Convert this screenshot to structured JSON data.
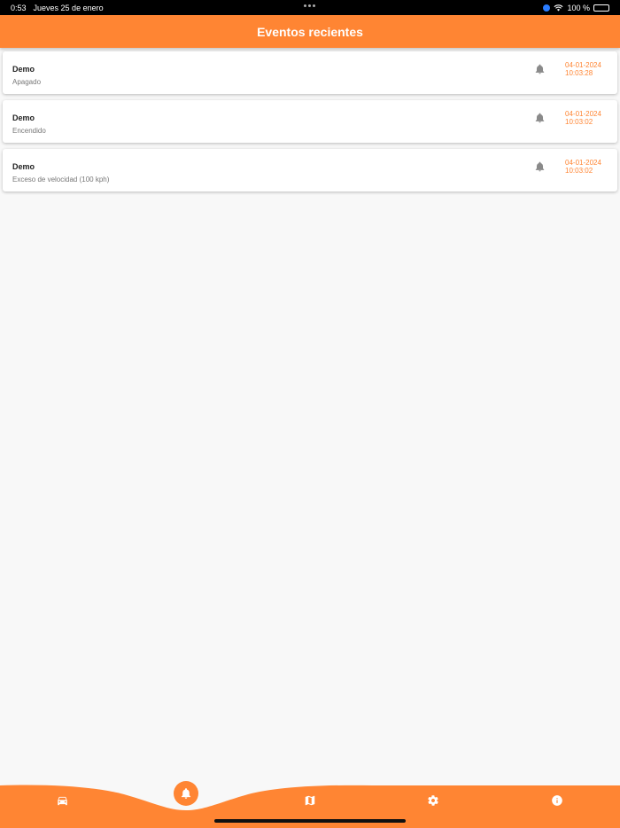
{
  "status_bar": {
    "time": "0:53",
    "date": "Jueves 25 de enero",
    "battery": "100 %"
  },
  "header": {
    "title": "Eventos recientes"
  },
  "events": [
    {
      "title": "Demo",
      "description": "Apagado",
      "date": "04-01-2024",
      "time": "10:03:28"
    },
    {
      "title": "Demo",
      "description": "Encendido",
      "date": "04-01-2024",
      "time": "10:03:02"
    },
    {
      "title": "Demo",
      "description": "Exceso de velocidad (100 kph)",
      "date": "04-01-2024",
      "time": "10:03:02"
    }
  ],
  "bottom_nav": {
    "items": [
      {
        "icon": "car-icon",
        "active": false
      },
      {
        "icon": "bell-icon",
        "active": true
      },
      {
        "icon": "map-icon",
        "active": false
      },
      {
        "icon": "gear-icon",
        "active": false
      },
      {
        "icon": "info-icon",
        "active": false
      }
    ]
  },
  "colors": {
    "accent": "#ff8533",
    "background": "#f8f8f8",
    "card": "#ffffff",
    "bell_gray": "#8a8a8a"
  }
}
